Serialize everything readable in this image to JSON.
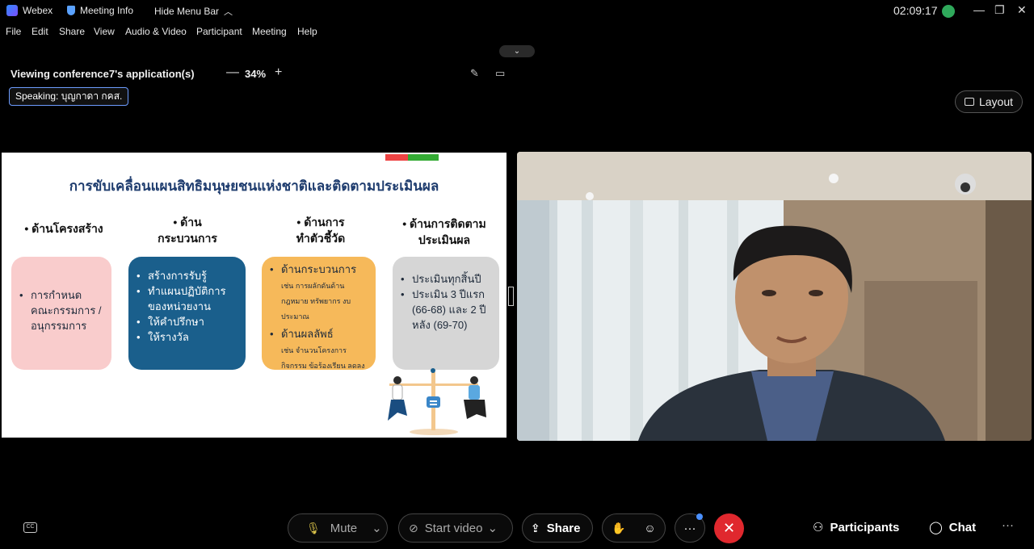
{
  "titlebar": {
    "app_name": "Webex",
    "meeting_info": "Meeting Info",
    "hide_menu_bar": "Hide Menu Bar",
    "clock": "02:09:17",
    "minimize": "—",
    "restore": "❐",
    "close": "✕"
  },
  "menu": [
    "File",
    "Edit",
    "Share",
    "View",
    "Audio & Video",
    "Participant",
    "Meeting",
    "Help"
  ],
  "collapse_chevron": "⌄",
  "share": {
    "viewing_label": "Viewing conference7's application(s)",
    "zoom_minus": "—",
    "zoom_value": "34%",
    "zoom_plus": "+",
    "speaking": "Speaking: บุญกาดา กคส."
  },
  "layout_button": "Layout",
  "slide": {
    "title": "การขับเคลื่อนแผนสิทธิมนุษยชนแห่งชาติและติดตามประเมินผล",
    "columns": [
      {
        "head": "• ด้านโครงสร้าง"
      },
      {
        "head": "• ด้าน\nกระบวนการ"
      },
      {
        "head": "• ด้านการ\nทำตัวชี้วัด"
      },
      {
        "head": "• ด้านการติดตาม\nประเมินผล"
      }
    ],
    "card1": [
      "การกำหนด คณะกรรมการ /อนุกรรมการ"
    ],
    "card2": [
      "สร้างการรับรู้",
      "ทำแผนปฏิบัติการของหน่วยงาน",
      "ให้คำปรึกษา",
      "ให้รางวัล"
    ],
    "card3": [
      {
        "main": "ด้านกระบวนการ",
        "sub": "เช่น การผลักดันด้านกฎหมาย ทรัพยากร งบประมาณ"
      },
      {
        "main": "ด้านผลลัพธ์",
        "sub": "เช่น จำนวนโครงการ กิจกรรม ข้อร้องเรียน ลดลง"
      }
    ],
    "card4": [
      "ประเมินทุกสิ้นปี",
      "ประเมิน 3 ปีแรก (66-68) และ 2 ปีหลัง (69-70)"
    ]
  },
  "toolbar": {
    "mute": "Mute",
    "start_video": "Start video",
    "share": "Share",
    "more": "···",
    "participants": "Participants",
    "chat": "Chat",
    "overflow": "···"
  },
  "colors": {
    "end_call": "#e0282e",
    "accent_blue": "#6d9cff",
    "card_pink": "#f9cccc",
    "card_blue": "#1a5f8c",
    "card_orange": "#f6b95a",
    "card_gray": "#d6d6d6"
  },
  "icons": [
    "webex-logo-icon",
    "shield-icon",
    "chevron-up-icon",
    "signal-icon",
    "annotate-icon",
    "screen-icon",
    "layout-icon",
    "captions-icon",
    "microphone-icon",
    "camera-off-icon",
    "share-icon",
    "raise-hand-icon",
    "reactions-icon",
    "end-call-icon",
    "participants-icon",
    "chat-icon"
  ]
}
